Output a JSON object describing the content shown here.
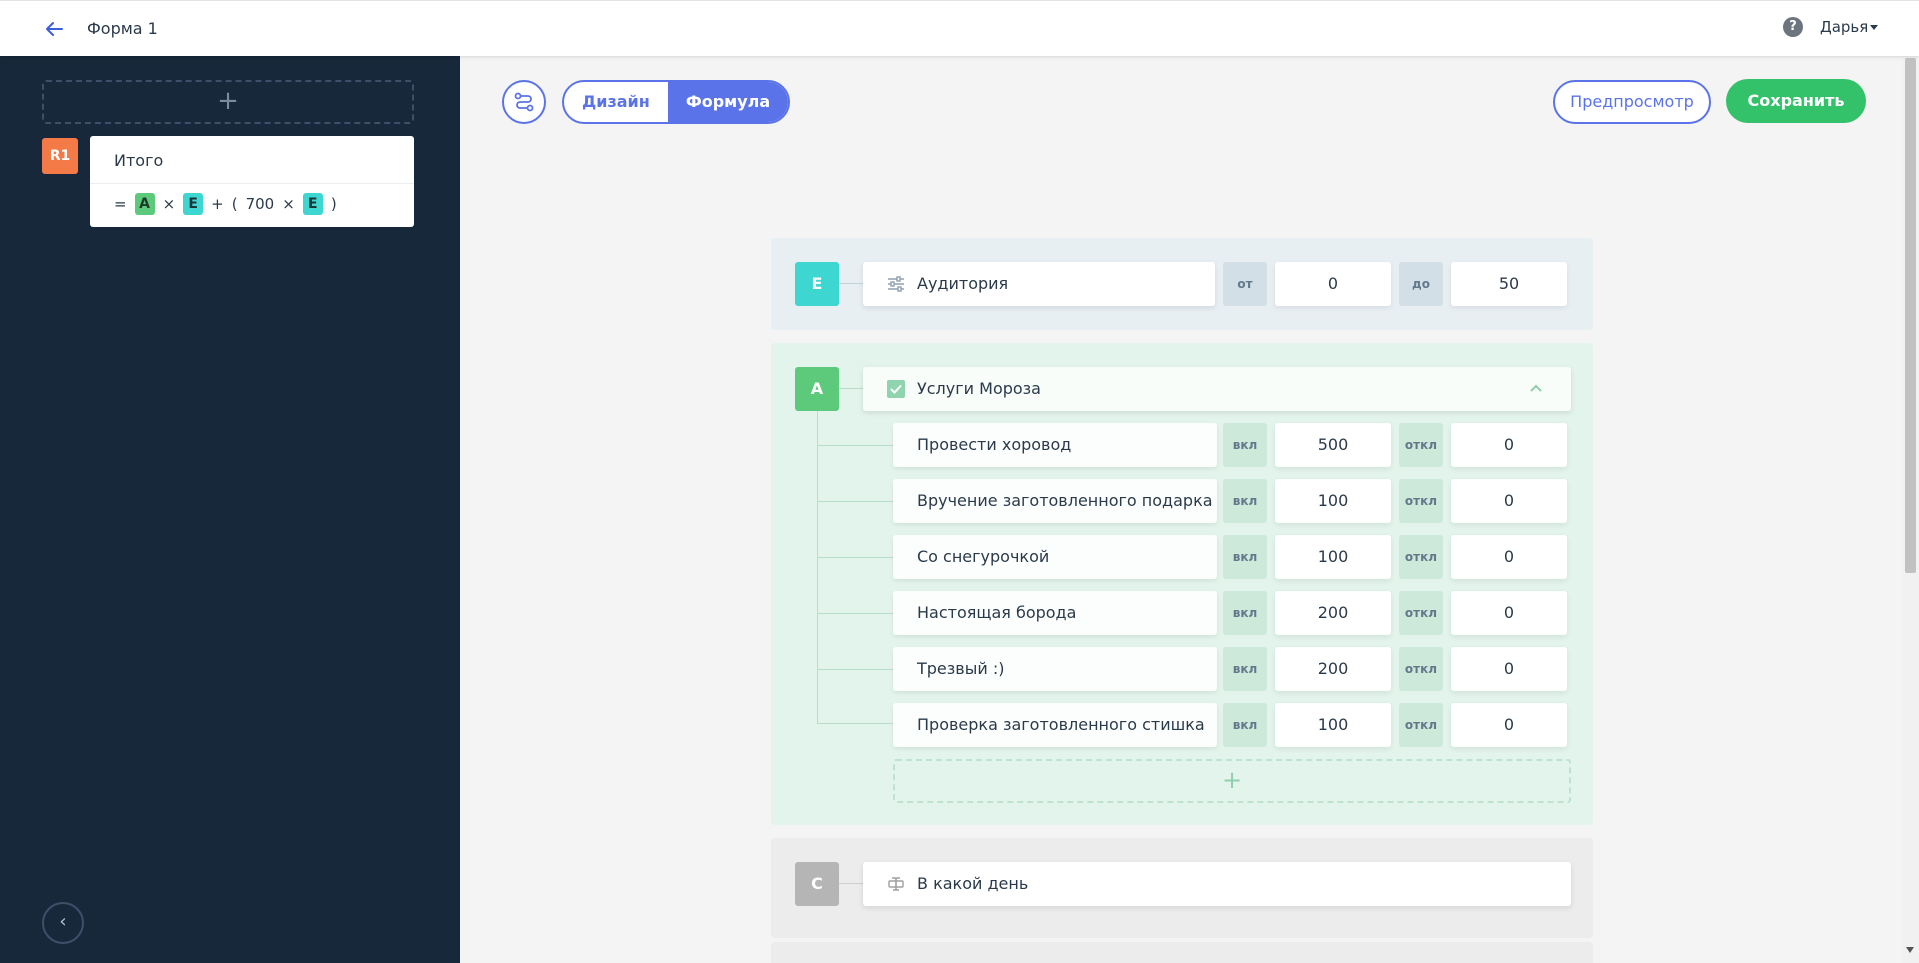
{
  "header": {
    "title": "Форма 1",
    "user_name": "Дарья",
    "help_glyph": "?",
    "back_icon": "arrow-left-icon"
  },
  "sidebar": {
    "add_glyph": "+",
    "result": {
      "badge": "R1",
      "title": "Итого",
      "formula": [
        "=",
        "A",
        "×",
        "E",
        "+",
        "(",
        "700",
        "×",
        "E",
        ")"
      ]
    },
    "collapse_glyph": "‹"
  },
  "toolbar": {
    "tabs": [
      {
        "label": "Дизайн",
        "active": false
      },
      {
        "label": "Формула",
        "active": true
      }
    ],
    "preview_label": "Предпросмотр",
    "save_label": "Сохранить"
  },
  "blocks": {
    "e": {
      "letter": "E",
      "label": "Аудитория",
      "icon": "sliders-icon",
      "from_label": "от",
      "from_value": "0",
      "to_label": "до",
      "to_value": "50"
    },
    "a": {
      "letter": "A",
      "label": "Услуги Мороза",
      "icon": "checkbox-icon",
      "on_label": "вкл",
      "off_label": "откл",
      "items": [
        {
          "name": "Провести хоровод",
          "on": "500",
          "off": "0"
        },
        {
          "name": "Вручение заготовленного подарка",
          "on": "100",
          "off": "0"
        },
        {
          "name": "Со снегурочкой",
          "on": "100",
          "off": "0"
        },
        {
          "name": "Настоящая борода",
          "on": "200",
          "off": "0"
        },
        {
          "name": "Трезвый :)",
          "on": "200",
          "off": "0"
        },
        {
          "name": "Проверка заготовленного стишка",
          "on": "100",
          "off": "0"
        }
      ],
      "add_glyph": "+"
    },
    "c": {
      "letter": "C",
      "label": "В какой день",
      "icon": "text-field-icon"
    }
  },
  "colors": {
    "accent": "#5b73e8",
    "save": "#33c26a",
    "sidebar_bg": "#17283a",
    "r1_badge": "#f47b47",
    "letter_e": "#3dd6d0",
    "letter_a": "#5cc97b",
    "letter_c": "#b5b5b5"
  }
}
